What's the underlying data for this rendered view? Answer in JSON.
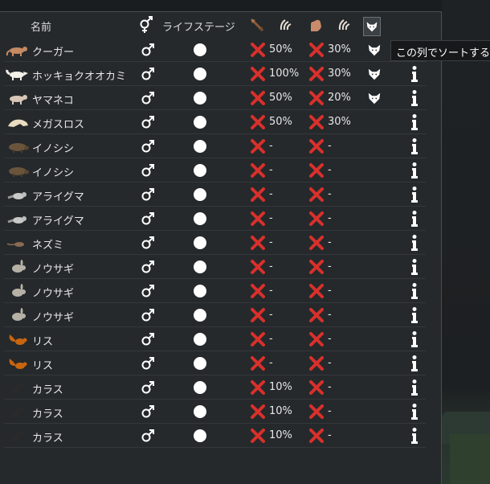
{
  "header": {
    "name": "名前",
    "life_stage": "ライフステージ"
  },
  "tooltip": "この列でソートする",
  "rows": [
    {
      "animal": "cougar",
      "name": "クーガー",
      "v1": "50%",
      "v2": "30%",
      "wolf": true
    },
    {
      "animal": "arctic-wolf",
      "name": "ホッキョクオオカミ",
      "v1": "100%",
      "v2": "30%",
      "wolf": true
    },
    {
      "animal": "lynx",
      "name": "ヤマネコ",
      "v1": "50%",
      "v2": "20%",
      "wolf": true
    },
    {
      "animal": "megasloth",
      "name": "メガスロス",
      "v1": "50%",
      "v2": "30%",
      "wolf": false
    },
    {
      "animal": "boar",
      "name": "イノシシ",
      "v1": "-",
      "v2": "-",
      "wolf": false
    },
    {
      "animal": "boar",
      "name": "イノシシ",
      "v1": "-",
      "v2": "-",
      "wolf": false
    },
    {
      "animal": "raccoon",
      "name": "アライグマ",
      "v1": "-",
      "v2": "-",
      "wolf": false
    },
    {
      "animal": "raccoon",
      "name": "アライグマ",
      "v1": "-",
      "v2": "-",
      "wolf": false
    },
    {
      "animal": "rat",
      "name": "ネズミ",
      "v1": "-",
      "v2": "-",
      "wolf": false
    },
    {
      "animal": "hare",
      "name": "ノウサギ",
      "v1": "-",
      "v2": "-",
      "wolf": false
    },
    {
      "animal": "hare",
      "name": "ノウサギ",
      "v1": "-",
      "v2": "-",
      "wolf": false
    },
    {
      "animal": "hare",
      "name": "ノウサギ",
      "v1": "-",
      "v2": "-",
      "wolf": false
    },
    {
      "animal": "squirrel",
      "name": "リス",
      "v1": "-",
      "v2": "-",
      "wolf": false
    },
    {
      "animal": "squirrel",
      "name": "リス",
      "v1": "-",
      "v2": "-",
      "wolf": false
    },
    {
      "animal": "crow",
      "name": "カラス",
      "v1": "10%",
      "v2": "-",
      "wolf": false
    },
    {
      "animal": "crow",
      "name": "カラス",
      "v1": "10%",
      "v2": "-",
      "wolf": false
    },
    {
      "animal": "crow",
      "name": "カラス",
      "v1": "10%",
      "v2": "-",
      "wolf": false
    }
  ],
  "colors": {
    "panel": "#25292b",
    "cross": "#d9302b",
    "text": "#e8e8e8"
  },
  "icons": {
    "gender": "male-icon",
    "stage": "life-stage-dot",
    "cross": "cross-icon",
    "wolf": "wolf-icon",
    "info": "info-icon"
  }
}
